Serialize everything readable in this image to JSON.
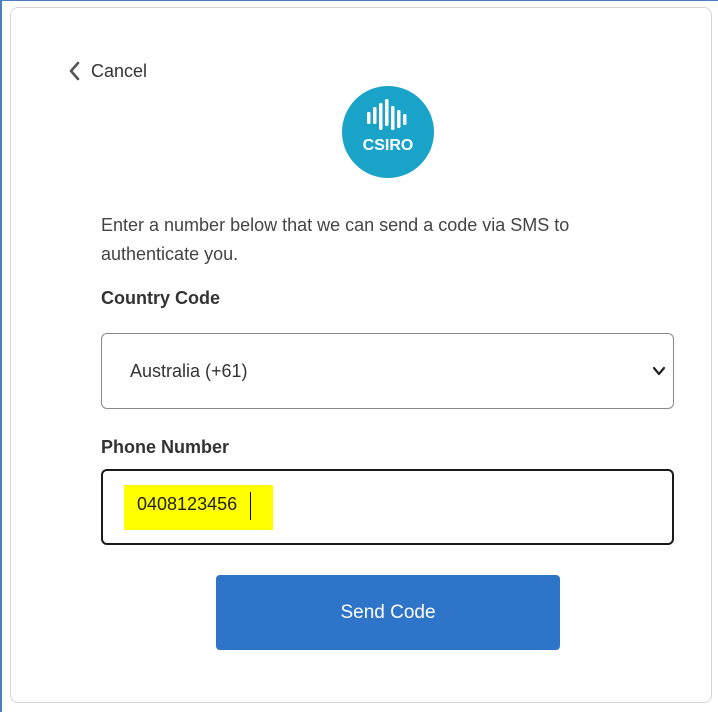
{
  "header": {
    "cancel_label": "Cancel",
    "cancel_icon": "chevron-left-icon"
  },
  "logo": {
    "text": "CSIRO",
    "brand_color": "#1aa3c9"
  },
  "form": {
    "intro_text": "Enter a number below that we can send a code via SMS to authenticate you.",
    "country_label": "Country Code",
    "country_value": "Australia (+61)",
    "phone_label": "Phone Number",
    "phone_value": "0408123456",
    "phone_highlight_color": "#ffff00",
    "send_label": "Send Code",
    "accent_color": "#2e74c9"
  }
}
